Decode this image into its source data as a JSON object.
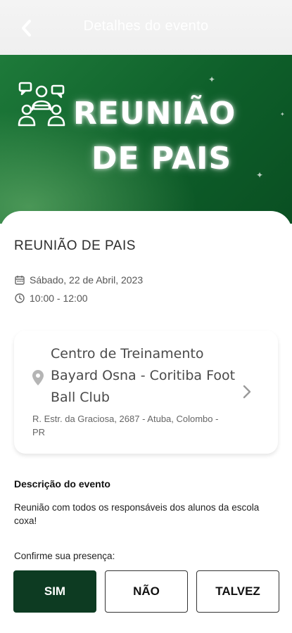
{
  "header": {
    "title": "Detalhes do evento",
    "back_icon": "chevron-left-icon"
  },
  "banner": {
    "line1": "REUNIÃO",
    "line2": "DE PAIS",
    "icon": "group-meeting-icon",
    "background_color": "#0e5f2a"
  },
  "event": {
    "name": "REUNIÃO DE PAIS",
    "date": "Sábado, 22 de Abril, 2023",
    "time": "10:00 - 12:00",
    "calendar_icon": "calendar-icon",
    "clock_icon": "clock-icon"
  },
  "location": {
    "name": "Centro de Treinamento Bayard Osna - Coritiba Foot Ball Club",
    "address": "R. Estr. da Graciosa, 2687 - Atuba, Colombo - PR",
    "pin_icon": "location-pin-icon",
    "chevron_icon": "chevron-right-icon"
  },
  "description": {
    "title": "Descrição do evento",
    "text": "Reunião com todos os responsáveis dos alunos da escola coxa!"
  },
  "rsvp": {
    "label": "Confirme sua presença:",
    "options": [
      "SIM",
      "NÃO",
      "TALVEZ"
    ],
    "selected": "SIM",
    "selected_color": "#0d3b22"
  }
}
